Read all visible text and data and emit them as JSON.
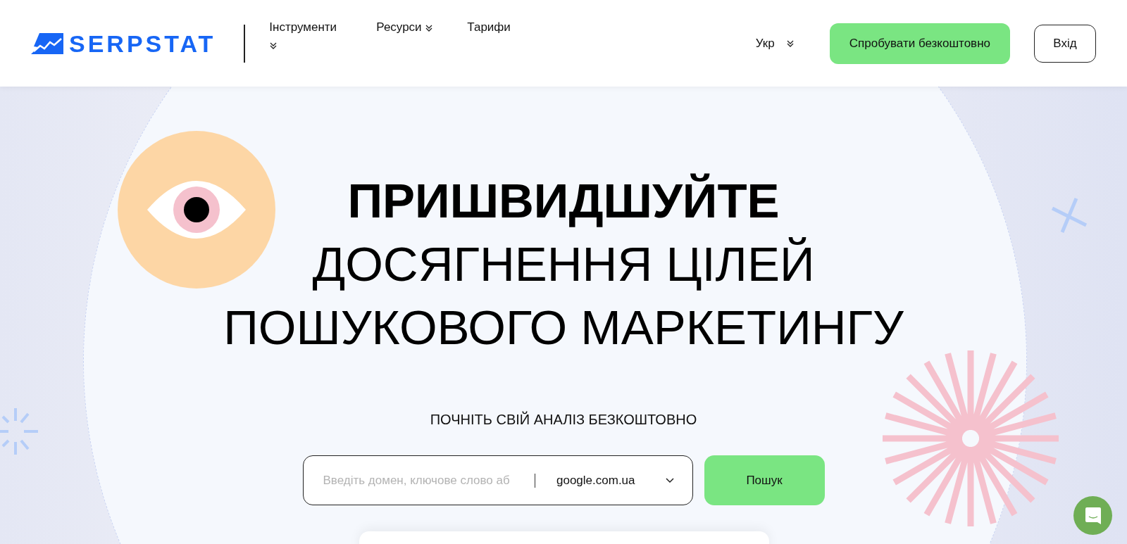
{
  "header": {
    "logo": "SERPSTAT",
    "nav": [
      {
        "label": "Інструменти",
        "dropdown": true
      },
      {
        "label": "Ресурси",
        "dropdown": true
      },
      {
        "label": "Тарифи",
        "dropdown": false
      }
    ],
    "language": {
      "label": "Укр",
      "dropdown": true
    },
    "trial_button": "Спробувати безкоштовно",
    "login_button": "Вхід"
  },
  "hero": {
    "title_lines": [
      {
        "text": "ПРИШВИДШУЙТЕ",
        "bold": true
      },
      {
        "text": "ДОСЯГНЕННЯ ЦІЛЕЙ",
        "bold": false
      },
      {
        "text": "ПОШУКОВОГО МАРКЕТИНГУ",
        "bold": false
      }
    ],
    "subtitle": "ПОЧНІТЬ СВІЙ АНАЛІЗ БЕЗКОШТОВНО",
    "search": {
      "placeholder": "Введіть домен, ключове слово аб",
      "engine": "google.com.ua",
      "button": "Пошук"
    }
  }
}
